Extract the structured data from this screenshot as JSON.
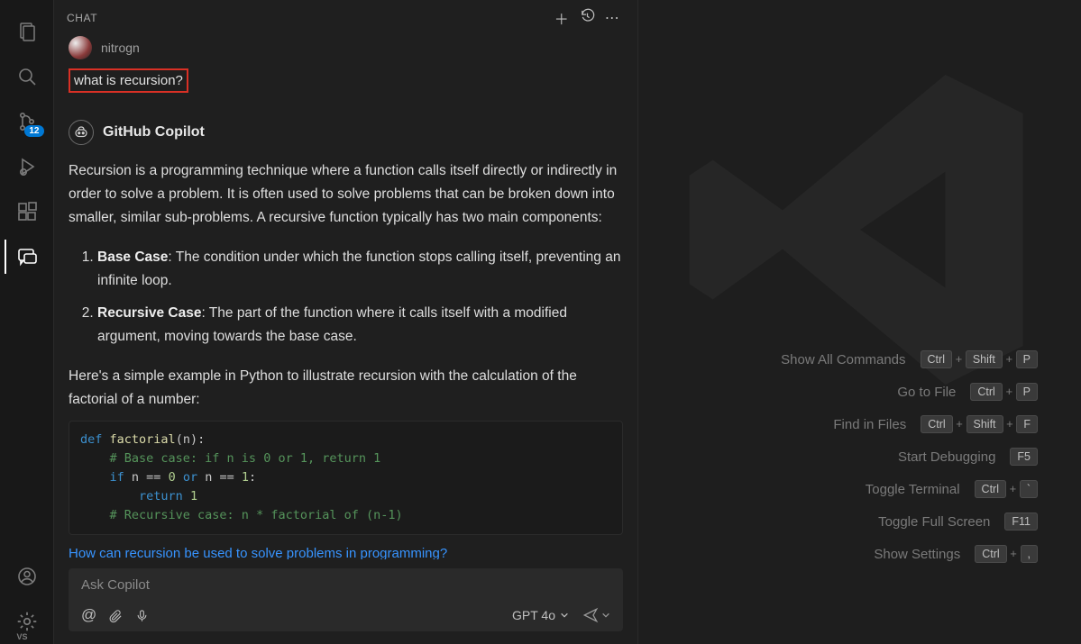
{
  "activity_bar": {
    "scm_badge": "12",
    "vs_label": "VS"
  },
  "chat": {
    "title": "CHAT",
    "user": {
      "name": "nitrogn",
      "question": "what is recursion?"
    },
    "bot": {
      "name": "GitHub Copilot",
      "intro": "Recursion is a programming technique where a function calls itself directly or indirectly in order to solve a problem. It is often used to solve problems that can be broken down into smaller, similar sub-problems. A recursive function typically has two main components:",
      "li1_term": "Base Case",
      "li1_rest": ": The condition under which the function stops calling itself, preventing an infinite loop.",
      "li2_term": "Recursive Case",
      "li2_rest": ": The part of the function where it calls itself with a modified argument, moving towards the base case.",
      "outro": "Here's a simple example in Python to illustrate recursion with the calculation of the factorial of a number:"
    },
    "code": {
      "l1a": "def",
      "l1b": " ",
      "l1c": "factorial",
      "l1d": "(n):",
      "l2": "    # Base case: if n is 0 or 1, return 1",
      "l3a": "    if",
      "l3b": " n == ",
      "l3c": "0",
      "l3d": " or",
      "l3e": " n == ",
      "l3f": "1",
      "l3g": ":",
      "l4a": "        return",
      "l4b": " ",
      "l4c": "1",
      "l5": "    # Recursive case: n * factorial of (n-1)"
    },
    "suggestion": "How can recursion be used to solve problems in programming?",
    "input": {
      "placeholder": "Ask Copilot",
      "at": "@",
      "model": "GPT 4o"
    }
  },
  "welcome": {
    "rows": [
      {
        "label": "Show All Commands",
        "keys": [
          "Ctrl",
          "+",
          "Shift",
          "+",
          "P"
        ]
      },
      {
        "label": "Go to File",
        "keys": [
          "Ctrl",
          "+",
          "P"
        ]
      },
      {
        "label": "Find in Files",
        "keys": [
          "Ctrl",
          "+",
          "Shift",
          "+",
          "F"
        ]
      },
      {
        "label": "Start Debugging",
        "keys": [
          "F5"
        ]
      },
      {
        "label": "Toggle Terminal",
        "keys": [
          "Ctrl",
          "+",
          "`"
        ]
      },
      {
        "label": "Toggle Full Screen",
        "keys": [
          "F11"
        ]
      },
      {
        "label": "Show Settings",
        "keys": [
          "Ctrl",
          "+",
          ","
        ]
      }
    ]
  }
}
